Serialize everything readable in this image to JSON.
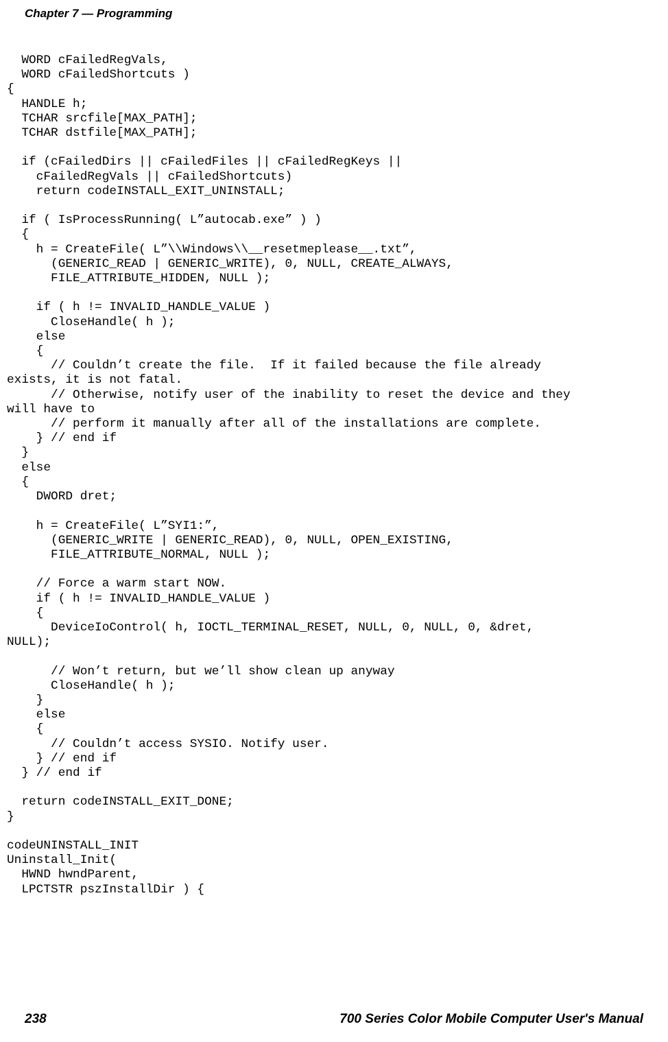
{
  "header": {
    "left": "Chapter 7  —  Programming"
  },
  "code": {
    "lines": [
      "  WORD cFailedRegVals,",
      "  WORD cFailedShortcuts )",
      "{",
      "  HANDLE h;",
      "  TCHAR srcfile[MAX_PATH];",
      "  TCHAR dstfile[MAX_PATH];",
      "",
      "  if (cFailedDirs || cFailedFiles || cFailedRegKeys ||",
      "    cFailedRegVals || cFailedShortcuts)",
      "    return codeINSTALL_EXIT_UNINSTALL;",
      "",
      "  if ( IsProcessRunning( L\"autocab.exe\" ) )",
      "  {",
      "    h = CreateFile( L\"\\\\Windows\\\\__resetmeplease__.txt\",",
      "      (GENERIC_READ | GENERIC_WRITE), 0, NULL, CREATE_ALWAYS,",
      "      FILE_ATTRIBUTE_HIDDEN, NULL );",
      "",
      "    if ( h != INVALID_HANDLE_VALUE )",
      "      CloseHandle( h );",
      "    else",
      "    {",
      "      // Couldn't create the file.  If it failed because the file already",
      "exists, it is not fatal.",
      "      // Otherwise, notify user of the inability to reset the device and they",
      "will have to",
      "      // perform it manually after all of the installations are complete.",
      "    } // end if",
      "  }",
      "  else",
      "  {",
      "    DWORD dret;",
      "",
      "    h = CreateFile( L\"SYI1:\",",
      "      (GENERIC_WRITE | GENERIC_READ), 0, NULL, OPEN_EXISTING,",
      "      FILE_ATTRIBUTE_NORMAL, NULL );",
      "",
      "    // Force a warm start NOW.",
      "    if ( h != INVALID_HANDLE_VALUE )",
      "    {",
      "      DeviceIoControl( h, IOCTL_TERMINAL_RESET, NULL, 0, NULL, 0, &dret,",
      "NULL);",
      "",
      "      // Won't return, but we'll show clean up anyway",
      "      CloseHandle( h );",
      "    }",
      "    else",
      "    {",
      "      // Couldn't access SYSIO. Notify user.",
      "    } // end if",
      "  } // end if",
      "",
      "  return codeINSTALL_EXIT_DONE;",
      "}",
      "",
      "codeUNINSTALL_INIT",
      "Uninstall_Init(",
      "  HWND hwndParent,",
      "  LPCTSTR pszInstallDir ) {"
    ]
  },
  "footer": {
    "page_number": "238",
    "title": "700 Series Color Mobile Computer User's Manual"
  }
}
